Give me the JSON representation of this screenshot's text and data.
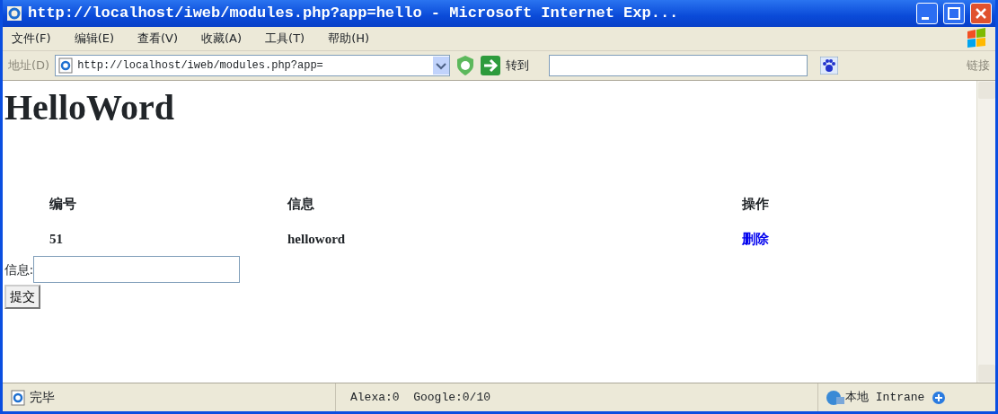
{
  "window": {
    "title": "http://localhost/iweb/modules.php?app=hello - Microsoft Internet Exp..."
  },
  "menu": [
    "文件(F)",
    "编辑(E)",
    "查看(V)",
    "收藏(A)",
    "工具(T)",
    "帮助(H)"
  ],
  "address_bar": {
    "label": "地址(D)",
    "value": "http://localhost/iweb/modules.php?app=",
    "go": "转到",
    "links": "链接"
  },
  "page": {
    "heading": "HelloWord",
    "table": {
      "columns": [
        "编号",
        "信息",
        "操作"
      ],
      "rows": [
        {
          "id": "51",
          "info": "helloword",
          "action": "删除"
        }
      ]
    },
    "form": {
      "label": "信息:",
      "button": "提交"
    }
  },
  "status_bar": {
    "text": "完毕",
    "stats": "Alexa:0  Google:0/10",
    "zone": "本地 Intrane"
  }
}
